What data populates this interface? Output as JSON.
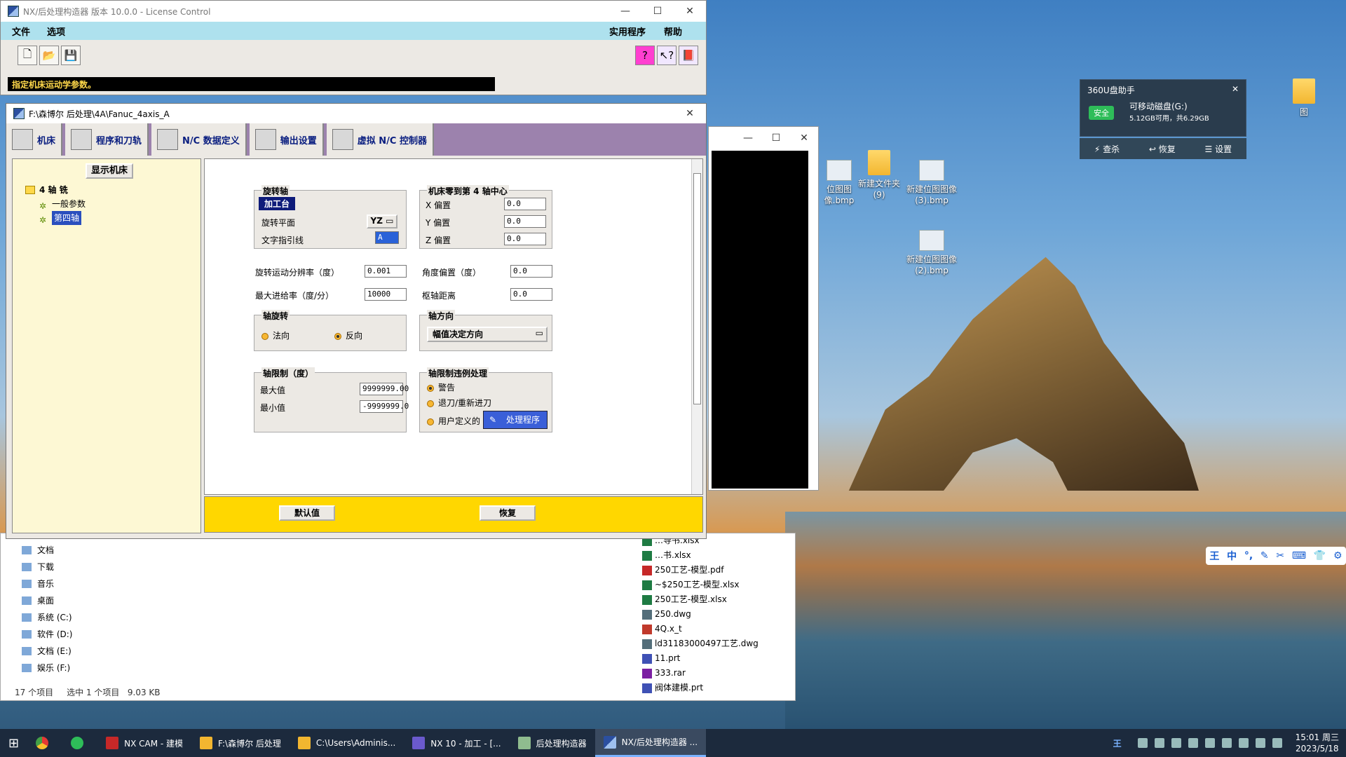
{
  "main_window": {
    "title": "NX/后处理构造器 版本 10.0.0 - License Control",
    "menu": {
      "file": "文件",
      "options": "选项",
      "utilities": "实用程序",
      "help": "帮助"
    },
    "toolbar_icons": [
      "new-file-icon",
      "open-folder-icon",
      "save-icon",
      "help-balloon-icon",
      "context-help-icon",
      "manual-book-icon"
    ],
    "status": "指定机床运动学参数。"
  },
  "sub_window": {
    "title": "F:\\森博尔 后处理\\4A\\Fanuc_4axis_A",
    "tabs": [
      "机床",
      "程序和刀轨",
      "N/C 数据定义",
      "输出设置",
      "虚拟 N/C 控制器"
    ],
    "show_machine_button": "显示机床",
    "tree": {
      "root": "4 轴 铣",
      "children": [
        "一般参数",
        "第四轴"
      ]
    },
    "rotary_axis": {
      "group_title": "旋转轴",
      "mode": "加工台",
      "plane_label": "旋转平面",
      "plane_value": "YZ",
      "leader_label": "文字指引线",
      "leader_value": "A"
    },
    "zero_center": {
      "group_title": "机床零到第 4 轴中心",
      "x_label": "X 偏置",
      "x_value": "0.0",
      "y_label": "Y 偏置",
      "y_value": "0.0",
      "z_label": "Z 偏置",
      "z_value": "0.0"
    },
    "resolution_label": "旋转运动分辨率（度）",
    "resolution_value": "0.001",
    "feed_label": "最大进给率（度/分）",
    "feed_value": "10000",
    "angle_offset_label": "角度偏置（度）",
    "angle_offset_value": "0.0",
    "pivot_label": "枢轴距离",
    "pivot_value": "0.0",
    "axis_rotation": {
      "group_title": "轴旋转",
      "normal": "法向",
      "reverse": "反向",
      "selected": "反向"
    },
    "axis_direction": {
      "group_title": "轴方向",
      "value": "幅值决定方向"
    },
    "axis_limits": {
      "group_title": "轴限制（度）",
      "max_label": "最大值",
      "max_value": "9999999.00",
      "min_label": "最小值",
      "min_value": "-9999999.0"
    },
    "limit_violation": {
      "group_title": "轴限制违例处理",
      "warning": "警告",
      "retract": "退刀/重新进刀",
      "user_defined": "用户定义的",
      "handler_button": "处理程序",
      "selected": "警告"
    },
    "default_button": "默认值",
    "restore_button": "恢复"
  },
  "explorer": {
    "nav": [
      "文档",
      "下载",
      "音乐",
      "桌面",
      "系统 (C:)",
      "软件 (D:)",
      "文档 (E:)",
      "娱乐 (F:)"
    ],
    "files": [
      "…导书.xlsx",
      "…书.xlsx",
      "250工艺-模型.pdf",
      "~$250工艺-模型.xlsx",
      "250工艺-模型.xlsx",
      "250.dwg",
      "4Q.x_t",
      "ld31183000497工艺.dwg",
      "11.prt",
      "333.rar",
      "阀体建模.prt"
    ],
    "status_count": "17 个项目",
    "status_selected": "选中 1 个项目",
    "status_size": "9.03 KB"
  },
  "desktop_icons": [
    "位图图像.bmp",
    "新建文件夹 (9)",
    "新建位图图像 (3).bmp",
    "新建位图图像 (2).bmp",
    "图"
  ],
  "widget_360": {
    "title": "360U盘助手",
    "badge": "安全",
    "drive": "可移动磁盘(G:)",
    "capacity": "5.12GB可用，共6.29GB",
    "actions": [
      "查杀",
      "恢复",
      "设置"
    ]
  },
  "ime": {
    "mode": "中"
  },
  "taskbar": {
    "items": [
      "NX CAM - 建模",
      "F:\\森博尔 后处理",
      "C:\\Users\\Adminis...",
      "NX 10 - 加工 - [...",
      "后处理构造器",
      "NX/后处理构造器 ..."
    ],
    "time": "15:01 周三",
    "date": "2023/5/18"
  }
}
